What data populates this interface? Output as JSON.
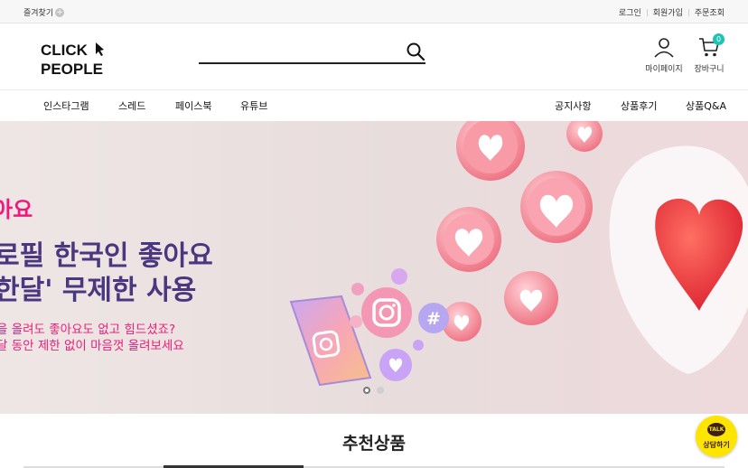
{
  "topbar": {
    "favorites_label": "즐겨찾기",
    "favorites_icon": "plus-icon",
    "links": [
      "로그인",
      "회원가입",
      "주문조회"
    ]
  },
  "header": {
    "logo": {
      "line1": "CLICK",
      "line2": "PEOPLE"
    },
    "search": {
      "placeholder": "",
      "value": ""
    },
    "mypage_label": "마이페이지",
    "cart_label": "장바구니",
    "cart_count": "0"
  },
  "nav": {
    "left": [
      "인스타그램",
      "스레드",
      "페이스북",
      "유튜브"
    ],
    "right": [
      "공지사항",
      "상품후기",
      "상품Q&A"
    ]
  },
  "hero": {
    "line1": "아요",
    "line2": "로필 한국인 좋아요",
    "line3": "한달' 무제한 사용",
    "line4": "을 올려도 좋아요도 없고 힘드셨죠?",
    "line5": "달 동안 제한 없이 마음껏 올려보세요",
    "active_slide": 1,
    "slide_count": 2
  },
  "section": {
    "title": "추천상품"
  },
  "kakao": {
    "bubble": "TALK",
    "label": "상담하기"
  },
  "colors": {
    "accent_pink": "#f0197b",
    "hero_purple": "#4b3680",
    "cart_badge": "#1ec3b6",
    "kakao_yellow": "#fee500"
  }
}
